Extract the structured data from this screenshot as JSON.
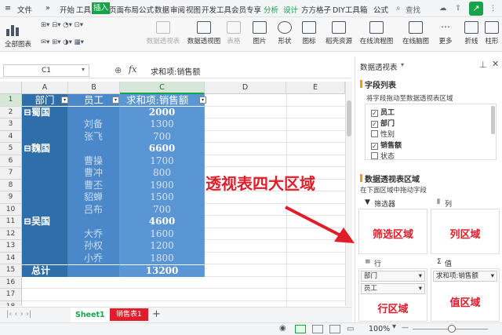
{
  "menubar": {
    "hamburger": "≡",
    "file": "文件",
    "more": "»",
    "tabs": [
      "开始",
      "工具",
      "插入",
      "页面布局",
      "公式",
      "数据",
      "审阅",
      "视图",
      "开发工具",
      "会员专享",
      "分析",
      "设计",
      "方方格子",
      "DIY工具箱",
      "公式"
    ],
    "active_tab": "插入",
    "search": "查找"
  },
  "ribbon": {
    "row1": [
      "全部图表",
      "",
      ""
    ],
    "items": [
      "数据透视表",
      "数据透视图",
      "表格",
      "图片",
      "形状",
      "图标",
      "稻壳资源",
      "在线流程图",
      "在线脑图",
      "更多",
      "折线",
      "柱形"
    ],
    "disabled": [
      "数据透视表",
      "表格"
    ]
  },
  "formula": {
    "namebox": "C1",
    "fx": "fx",
    "value": "求和项:销售额"
  },
  "columns": [
    "A",
    "B",
    "C",
    "D",
    "E"
  ],
  "rows": [
    "1",
    "2",
    "3",
    "4",
    "5",
    "6",
    "7",
    "8",
    "9",
    "10",
    "11",
    "12",
    "13",
    "14",
    "15",
    "16",
    "17",
    "18"
  ],
  "table": {
    "header": [
      "部门",
      "员工",
      "求和项:销售额"
    ],
    "data": [
      [
        "⊟蜀国",
        "",
        "2000"
      ],
      [
        "",
        "刘备",
        "1300"
      ],
      [
        "",
        "张飞",
        "700"
      ],
      [
        "⊟魏国",
        "",
        "6600"
      ],
      [
        "",
        "曹操",
        "1700"
      ],
      [
        "",
        "曹冲",
        "800"
      ],
      [
        "",
        "曹丕",
        "1900"
      ],
      [
        "",
        "貂蝉",
        "1500"
      ],
      [
        "",
        "吕布",
        "700"
      ],
      [
        "⊟吴国",
        "",
        "4600"
      ],
      [
        "",
        "大乔",
        "1600"
      ],
      [
        "",
        "孙权",
        "1200"
      ],
      [
        "",
        "小乔",
        "1800"
      ],
      [
        "总计",
        "",
        "13200"
      ]
    ]
  },
  "annotation": "透视表四大区域",
  "sheets": [
    "Sheet1",
    "销售表1"
  ],
  "add_sheet": "+",
  "status": {
    "zoom": "100%",
    "minus": "—"
  },
  "pane": {
    "title": "数据透视表",
    "field_list_title": "字段列表",
    "field_hint": "将字段拖动至数据透视表区域",
    "fields": [
      {
        "name": "员工",
        "checked": true
      },
      {
        "name": "部门",
        "checked": true
      },
      {
        "name": "性别",
        "checked": false
      },
      {
        "name": "销售额",
        "checked": true
      },
      {
        "name": "状态",
        "checked": false
      }
    ],
    "areas_title": "数据透视表区域",
    "areas_hint": "在下面区域中拖动字段",
    "filter_label": "筛选器",
    "col_label": "列",
    "row_label": "行",
    "val_label": "值",
    "filter_area": "筛选区域",
    "col_area": "列区域",
    "row_area": "行区域",
    "val_area": "值区域",
    "row_items": [
      "部门",
      "员工"
    ],
    "val_items": [
      "求和项:销售额"
    ]
  },
  "colors": {
    "accent": "#16a34a",
    "red": "#e11d2a",
    "blue_dark": "#2f6ea9",
    "blue_mid": "#4a88c9",
    "blue_light": "#5a95d4"
  }
}
